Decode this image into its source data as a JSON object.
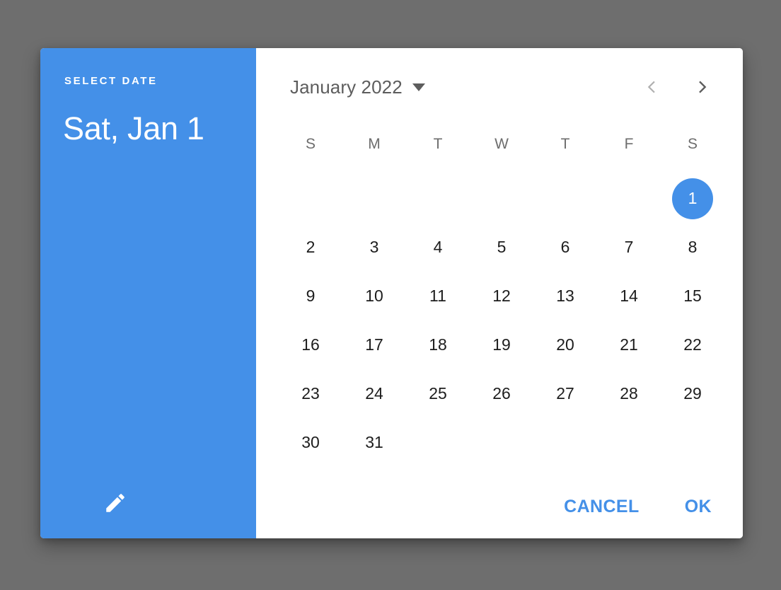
{
  "colors": {
    "accent": "#4490e8",
    "scrim": "#6e6e6e",
    "surface": "#ffffff",
    "on_surface": "#1d1d1d",
    "muted": "#6d6d6d",
    "nav_disabled": "#b0b0b0",
    "nav_enabled": "#5d5d5d"
  },
  "header": {
    "overline": "SELECT DATE",
    "selected_date": "Sat, Jan 1",
    "edit_icon": "pencil-icon"
  },
  "calendar": {
    "month_label": "January 2022",
    "dropdown_icon": "chevron-down-icon",
    "prev_icon": "chevron-left-icon",
    "next_icon": "chevron-right-icon",
    "weekdays": [
      "S",
      "M",
      "T",
      "W",
      "T",
      "F",
      "S"
    ],
    "leading_blanks": 6,
    "days": [
      1,
      2,
      3,
      4,
      5,
      6,
      7,
      8,
      9,
      10,
      11,
      12,
      13,
      14,
      15,
      16,
      17,
      18,
      19,
      20,
      21,
      22,
      23,
      24,
      25,
      26,
      27,
      28,
      29,
      30,
      31
    ],
    "selected_day": 1
  },
  "actions": {
    "cancel_label": "CANCEL",
    "ok_label": "OK"
  }
}
